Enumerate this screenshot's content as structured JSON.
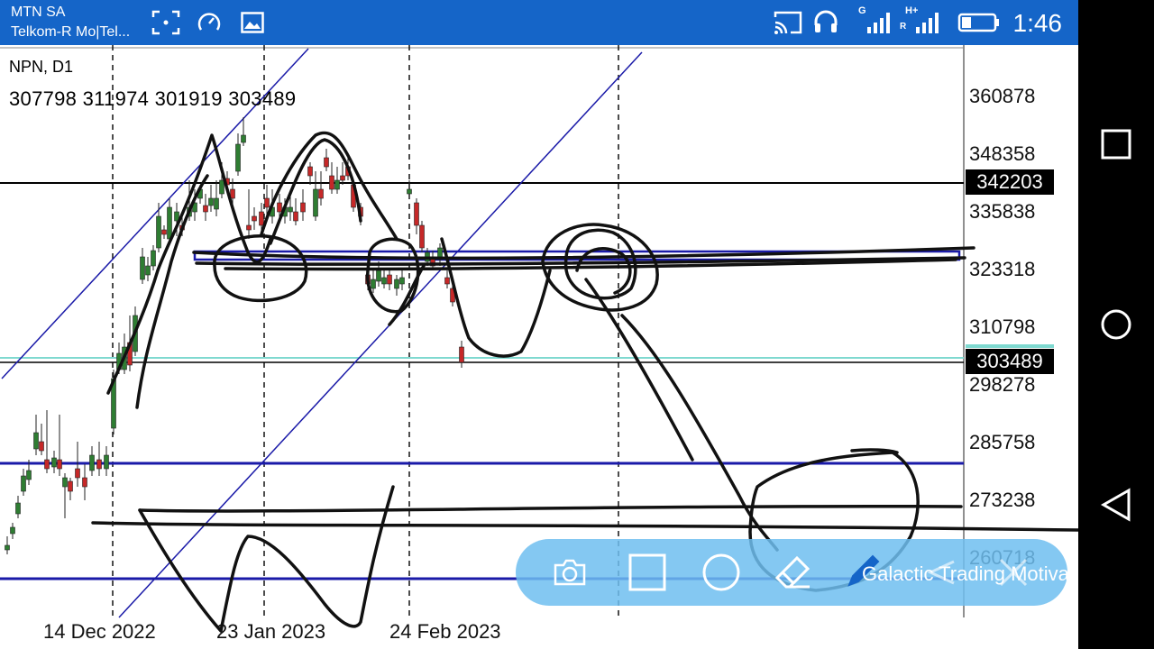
{
  "status_bar": {
    "carrier_line1": "MTN SA",
    "carrier_line2": "Telkom-R Mo|Tel...",
    "signal_1_label": "G",
    "signal_2_label": "H+",
    "signal_2_sub": "R",
    "time": "1:46",
    "background": "#1565c8"
  },
  "chart": {
    "symbol": "NPN, D1",
    "ohlc": "307798 311974 301919 303489",
    "price_axis": [
      "360878",
      "348358",
      "335838",
      "323318",
      "310798",
      "298278",
      "285758",
      "273238",
      "260718"
    ],
    "price_tags": [
      {
        "value": "342203",
        "color": "#000000"
      },
      {
        "value": "303489",
        "color": "#000000"
      }
    ],
    "date_axis": [
      "14 Dec 2022",
      "23 Jan 2023",
      "24 Feb 2023"
    ],
    "colors": {
      "bull": "#2e7d32",
      "bear": "#c62828",
      "line_blue": "#1a1aa8",
      "line_black": "#000000",
      "bid_line": "#7fd9d0"
    }
  },
  "toolbar": {
    "tools": [
      "camera-icon",
      "rectangle-icon",
      "circle-icon",
      "eraser-icon",
      "pen-icon",
      "undo-icon",
      "close-icon"
    ],
    "watermark": "Galactic Trading Motivation"
  },
  "nav_bar": {
    "buttons": [
      "recents-icon",
      "home-icon",
      "back-icon"
    ]
  }
}
